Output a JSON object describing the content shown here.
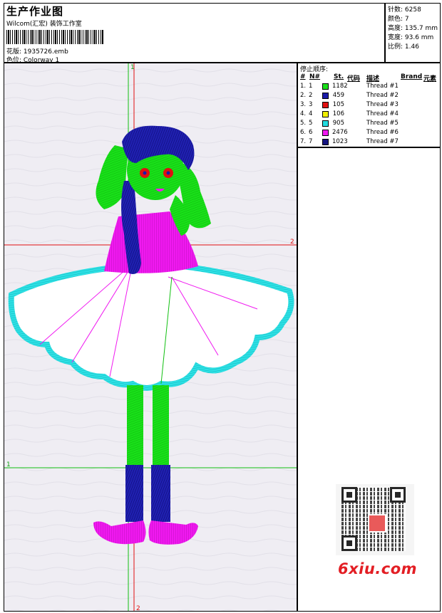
{
  "header": {
    "title": "生产作业图",
    "company": "Wilcom(汇宏) 装饰工作室",
    "file_label": "花版: 1935726.emb",
    "colorway_label": "色位: Colorway 1"
  },
  "stats": [
    "针数: 6258",
    "颜色: 7",
    "高度: 135.7 mm",
    "宽度: 93.6 mm",
    "比例: 1.46"
  ],
  "threads": {
    "title": "停止顺序:",
    "headers": [
      "#",
      "N#",
      "St.",
      "代码",
      "描述",
      "Brand",
      "元素"
    ],
    "rows": [
      {
        "idx": "1.",
        "n": "1",
        "stitches": "1182",
        "color": "#19e019",
        "desc": "Thread #1"
      },
      {
        "idx": "2.",
        "n": "2",
        "stitches": "459",
        "color": "#1a1aa8",
        "desc": "Thread #2"
      },
      {
        "idx": "3.",
        "n": "3",
        "stitches": "105",
        "color": "#e01010",
        "desc": "Thread #3"
      },
      {
        "idx": "4.",
        "n": "4",
        "stitches": "106",
        "color": "#f0f000",
        "desc": "Thread #4"
      },
      {
        "idx": "5.",
        "n": "5",
        "stitches": "905",
        "color": "#22dde0",
        "desc": "Thread #5"
      },
      {
        "idx": "6.",
        "n": "6",
        "stitches": "2476",
        "color": "#f019f0",
        "desc": "Thread #6"
      },
      {
        "idx": "7.",
        "n": "7",
        "stitches": "1023",
        "color": "#141480",
        "desc": "Thread #7"
      }
    ]
  },
  "guides": {
    "h_top_label": "2",
    "h_bottom_label": "1",
    "v_top_label": "1",
    "v_bottom_label": "2"
  },
  "watermark": {
    "text": "6xiu.com"
  }
}
